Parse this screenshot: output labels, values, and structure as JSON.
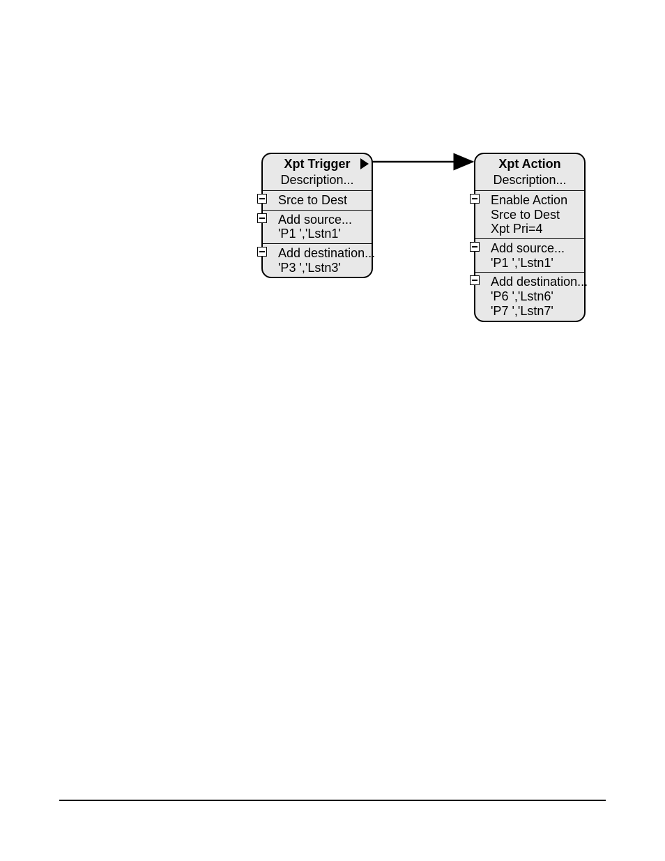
{
  "trigger": {
    "title": "Xpt Trigger",
    "description": "Description...",
    "section1": {
      "line1": "Srce to Dest"
    },
    "section2": {
      "header": "Add source...",
      "item1": "'P1   ','Lstn1'"
    },
    "section3": {
      "header": "Add destination...",
      "item1": "'P3   ','Lstn3'"
    }
  },
  "action": {
    "title": "Xpt Action",
    "description": "Description...",
    "section1": {
      "line1": "Enable Action",
      "line2": "Srce to Dest",
      "line3": "Xpt Pri=4"
    },
    "section2": {
      "header": "Add source...",
      "item1": "'P1   ','Lstn1'"
    },
    "section3": {
      "header": "Add destination...",
      "item1": "'P6   ','Lstn6'",
      "item2": "'P7   ','Lstn7'"
    }
  }
}
